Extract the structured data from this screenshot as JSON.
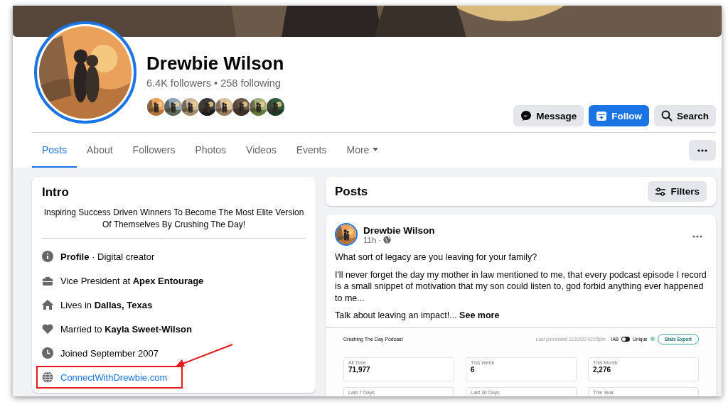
{
  "cover": {
    "kind": "picture"
  },
  "profile": {
    "avatar": {
      "kind": "picture"
    },
    "name": "Drewbie Wilson",
    "followers": "6.4K followers",
    "separator": "•",
    "following": "258 following",
    "friend_avatars": [
      {
        "kind": "picture"
      },
      {
        "kind": "picture"
      },
      {
        "kind": "picture"
      },
      {
        "kind": "picture"
      },
      {
        "kind": "picture"
      },
      {
        "kind": "picture"
      },
      {
        "kind": "picture"
      },
      {
        "kind": "picture"
      }
    ]
  },
  "actions": [
    {
      "label": "Message",
      "kind": "secondary"
    },
    {
      "label": "Follow",
      "kind": "primary"
    },
    {
      "label": "Search",
      "kind": "secondary"
    }
  ],
  "tabs": [
    {
      "label": "Posts",
      "selected": true,
      "kind": "tab"
    },
    {
      "label": "About",
      "selected": false,
      "kind": "tab"
    },
    {
      "label": "Followers",
      "selected": false,
      "kind": "tab"
    },
    {
      "label": "Photos",
      "selected": false,
      "kind": "tab"
    },
    {
      "label": "Videos",
      "selected": false,
      "kind": "tab"
    },
    {
      "label": "Events",
      "selected": false,
      "kind": "tab"
    },
    {
      "label": "More",
      "selected": false,
      "kind": "menu"
    }
  ],
  "intro": {
    "title": "Intro",
    "bio": "Inspiring Success Driven Winners To Become The Most Elite Version Of Themselves By Crushing The Day!",
    "items": [
      {
        "kind": "info",
        "text": "**Profile** · Digital creator",
        "highlighted": false
      },
      {
        "kind": "work",
        "text": "Vice President at **Apex Entourage**",
        "highlighted": false
      },
      {
        "kind": "home",
        "text": "Lives in **Dallas, Texas**",
        "highlighted": false
      },
      {
        "kind": "relationship",
        "text": "Married to **Kayla Sweet-Wilson**",
        "highlighted": false
      },
      {
        "kind": "joined",
        "text": "Joined September 2007",
        "highlighted": false
      },
      {
        "kind": "website",
        "text": "ConnectWithDrewbie.com",
        "highlighted": true
      }
    ]
  },
  "posts_header": {
    "title": "Posts",
    "filter_button": "Filters"
  },
  "post": {
    "avatar": {
      "kind": "picture"
    },
    "author": "Drewbie Wilson",
    "time": "11h",
    "separator": "·",
    "paragraphs": [
      "What sort of legacy are you leaving for your family?",
      "I'll never forget the day my mother in law mentioned to me,  that every podcast episode I record is a small snippet of motivation that my son could listen to, god forbid anything ever happened to me..."
    ],
    "teaser": "Talk about leaving an impact!...",
    "see_more": "See more",
    "attachment": {
      "title": "Crushing The Day Podcast",
      "processed": "Last processed 11/23/22 02:05pm",
      "toggle_left": "IAB",
      "toggle": {
        "on": false
      },
      "toggle_right": "Unique",
      "export_button": "Stats Export",
      "stats": [
        {
          "label": "All Time",
          "value": "71,977"
        },
        {
          "label": "This Week",
          "value": "6"
        },
        {
          "label": "This Month",
          "value": "2,276"
        },
        {
          "label": "Last 7 Days"
        },
        {
          "label": "Last 30 Days"
        },
        {
          "label": "This Year"
        }
      ]
    }
  }
}
